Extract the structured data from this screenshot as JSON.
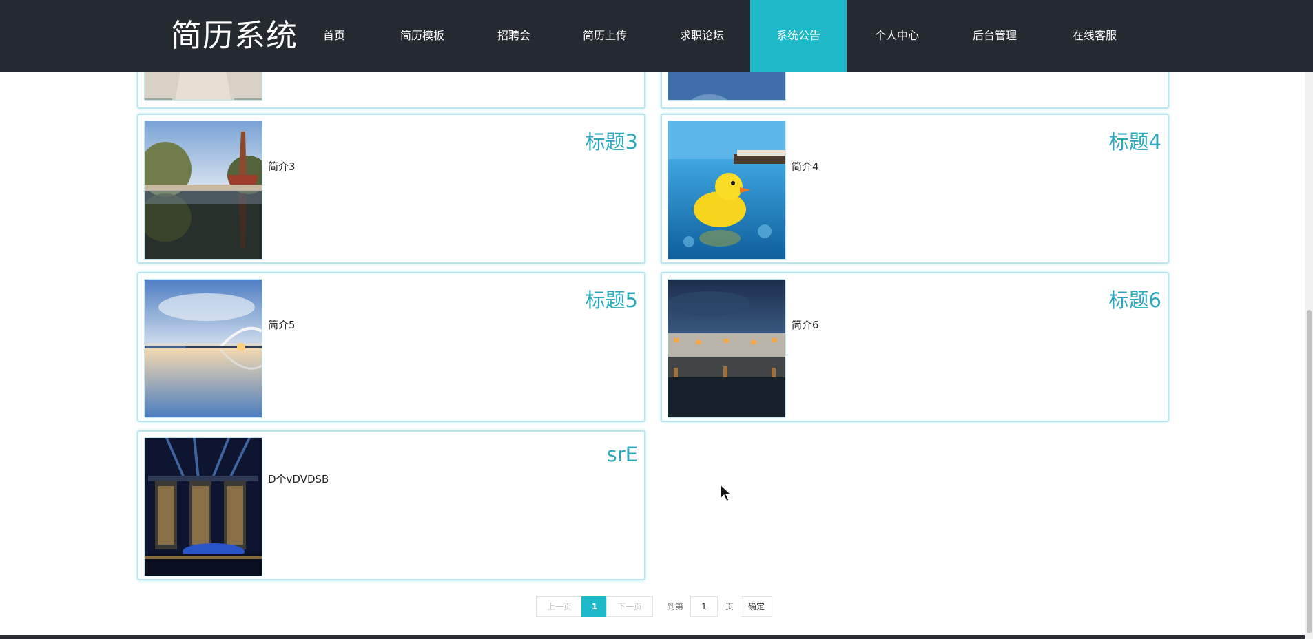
{
  "brand": "简历系统",
  "nav": {
    "items": [
      {
        "label": "首页",
        "active": false
      },
      {
        "label": "简历模板",
        "active": false
      },
      {
        "label": "招聘会",
        "active": false
      },
      {
        "label": "简历上传",
        "active": false
      },
      {
        "label": "求职论坛",
        "active": false
      },
      {
        "label": "系统公告",
        "active": true
      },
      {
        "label": "个人中心",
        "active": false
      },
      {
        "label": "后台管理",
        "active": false
      },
      {
        "label": "在线客服",
        "active": false
      }
    ]
  },
  "cards": [
    {
      "title": "标题3",
      "desc": "简介3",
      "image": "pagoda-lake-photo"
    },
    {
      "title": "标题4",
      "desc": "简介4",
      "image": "rubber-duck-pool-photo"
    },
    {
      "title": "标题5",
      "desc": "简介5",
      "image": "bridge-sunset-photo"
    },
    {
      "title": "标题6",
      "desc": "简介6",
      "image": "village-night-photo"
    },
    {
      "title": "srE",
      "desc": "D个vDVDSB",
      "image": "city-lights-photo"
    }
  ],
  "pagination": {
    "prev": "上一页",
    "current": "1",
    "next": "下一页",
    "goto_label": "到第",
    "page_value": "1",
    "page_unit": "页",
    "confirm": "确定"
  },
  "colors": {
    "nav_bg": "#252930",
    "accent": "#1eb9c9",
    "title": "#2ba9bb",
    "card_border": "#b9e6ec"
  }
}
